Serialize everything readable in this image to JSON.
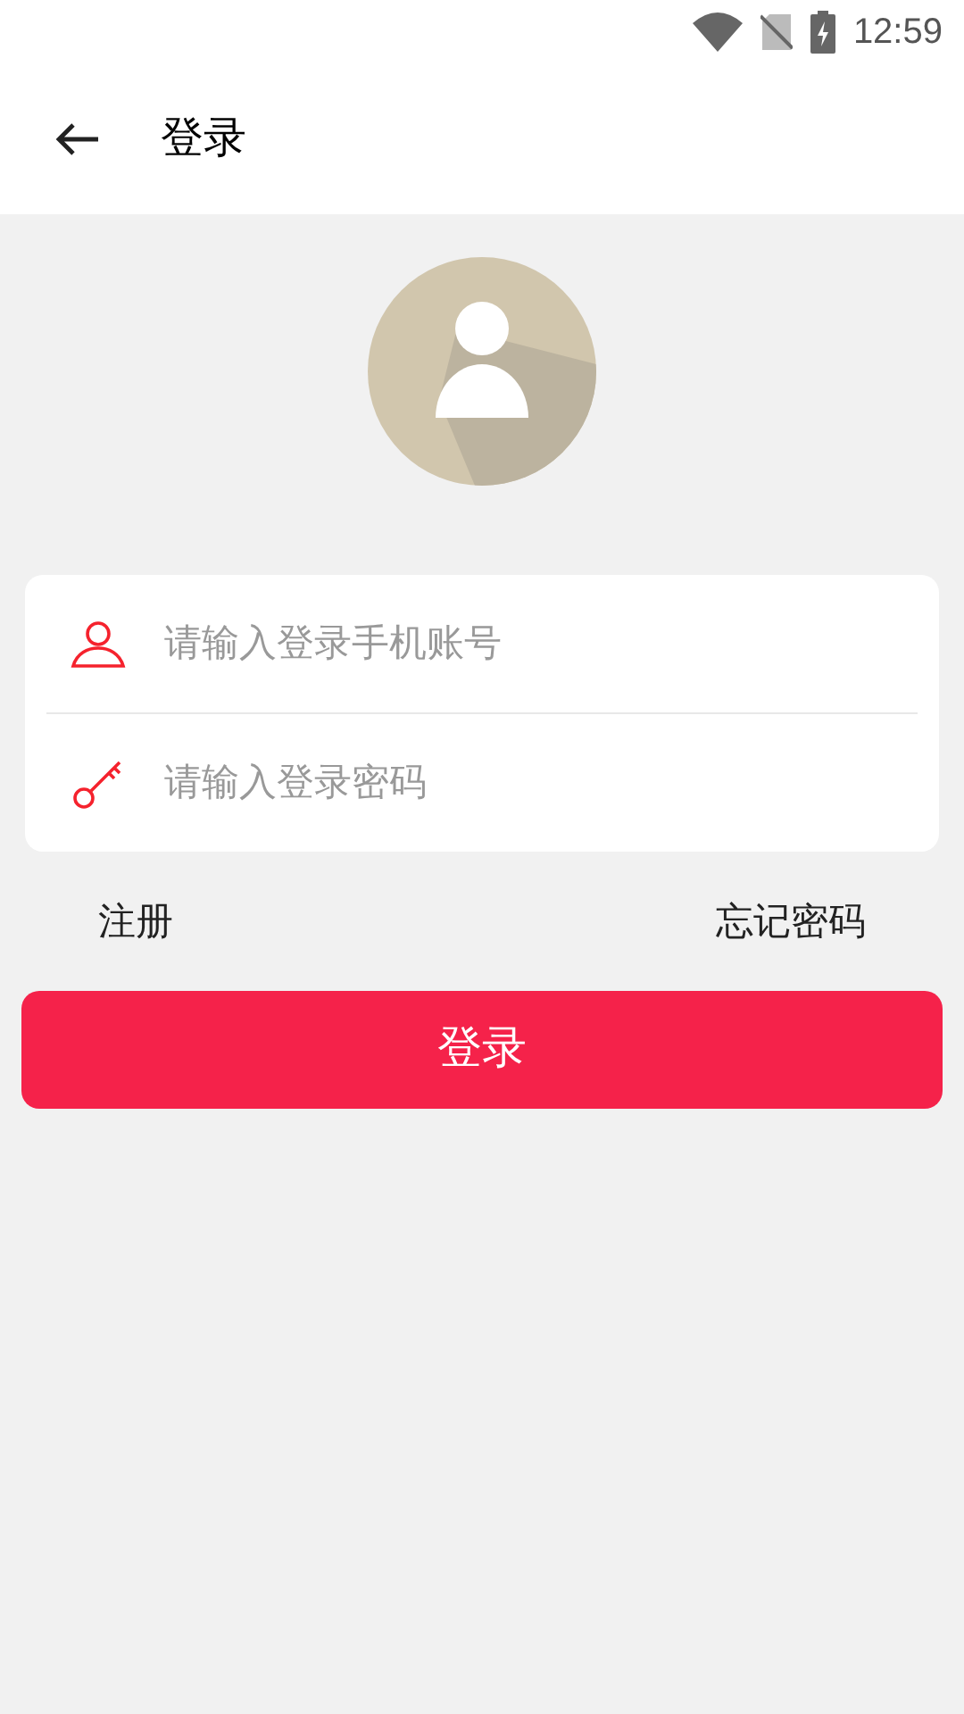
{
  "status_bar": {
    "time": "12:59"
  },
  "header": {
    "title": "登录"
  },
  "login_form": {
    "fields": [
      {
        "kind": "user",
        "placeholder": "请输入登录手机账号"
      },
      {
        "kind": "key",
        "placeholder": "请输入登录密码"
      }
    ]
  },
  "links": {
    "register": "注册",
    "forgot_password": "忘记密码"
  },
  "login_button": {
    "label": "登录"
  }
}
